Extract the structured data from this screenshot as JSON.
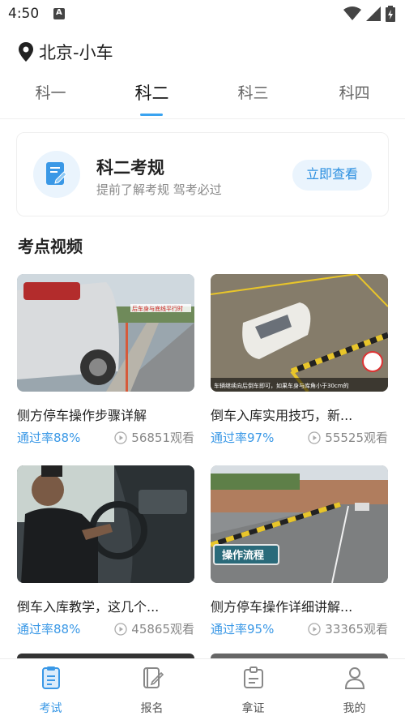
{
  "status_bar": {
    "time": "4:50"
  },
  "location": {
    "text": "北京-小车"
  },
  "tabs": [
    {
      "label": "科一",
      "active": false
    },
    {
      "label": "科二",
      "active": true
    },
    {
      "label": "科三",
      "active": false
    },
    {
      "label": "科四",
      "active": false
    }
  ],
  "rules_card": {
    "title": "科二考规",
    "subtitle": "提前了解考规 驾考必过",
    "button_label": "立即查看"
  },
  "section": {
    "title": "考点视频"
  },
  "videos": [
    {
      "title": "侧方停车操作步骤详解",
      "pass_rate": "通过率88%",
      "views": "56851观看"
    },
    {
      "title": "倒车入库实用技巧，新...",
      "pass_rate": "通过率97%",
      "views": "55525观看"
    },
    {
      "title": "倒车入库教学，这几个...",
      "pass_rate": "通过率88%",
      "views": "45865观看"
    },
    {
      "title": "侧方停车操作详细讲解...",
      "pass_rate": "通过率95%",
      "views": "33365观看"
    }
  ],
  "thumbnails": [
    {
      "overlay_text": "后车身与底线平行时"
    },
    {
      "overlay_text": "车辆继续向后倒车即可，如果车身与库角小于30cm的"
    },
    {
      "overlay_text": ""
    },
    {
      "overlay_text": "操作流程"
    }
  ],
  "bottom_nav": [
    {
      "label": "考试",
      "icon": "exam-icon",
      "active": true
    },
    {
      "label": "报名",
      "icon": "signup-icon",
      "active": false
    },
    {
      "label": "拿证",
      "icon": "license-icon",
      "active": false
    },
    {
      "label": "我的",
      "icon": "profile-icon",
      "active": false
    }
  ],
  "colors": {
    "accent": "#3a98e6",
    "accent_light": "#eaf4fd"
  }
}
